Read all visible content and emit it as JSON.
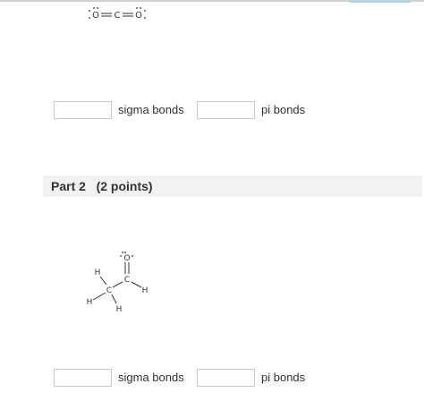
{
  "molecule1": {
    "atoms": [
      "O",
      "C",
      "O"
    ]
  },
  "question1": {
    "sigma_label": "sigma bonds",
    "pi_label": "pi bonds",
    "sigma_value": "",
    "pi_value": ""
  },
  "part2": {
    "title": "Part 2   (2 points)"
  },
  "molecule2": {
    "atoms": [
      "O",
      "C",
      "H",
      "H",
      "H",
      "C",
      "H"
    ]
  },
  "question2": {
    "sigma_label": "sigma bonds",
    "pi_label": "pi bonds",
    "sigma_value": "",
    "pi_value": ""
  }
}
